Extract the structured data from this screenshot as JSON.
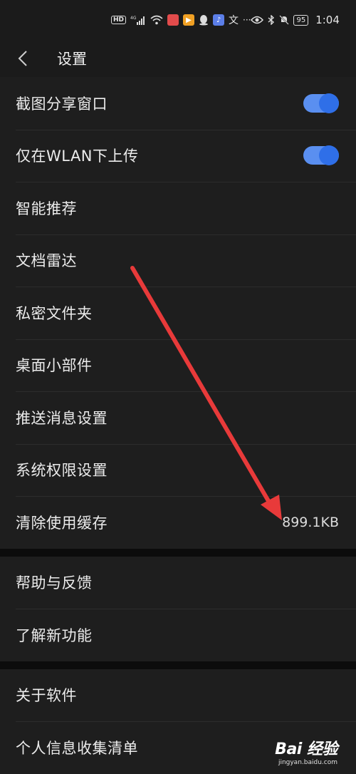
{
  "status_bar": {
    "hd": "HD",
    "network": "4G",
    "battery": "95",
    "time": "1:04",
    "icons": [
      "hd-icon",
      "signal-icon",
      "wifi-icon",
      "app-notification-icon",
      "qq-icon",
      "translate-icon",
      "more-icon",
      "eye-icon",
      "bluetooth-icon",
      "mute-icon",
      "battery-icon"
    ]
  },
  "header": {
    "title": "设置"
  },
  "groups": [
    {
      "rows": [
        {
          "label": "截图分享窗口",
          "toggle": true
        },
        {
          "label": "仅在WLAN下上传",
          "toggle": true
        },
        {
          "label": "智能推荐"
        },
        {
          "label": "文档雷达"
        },
        {
          "label": "私密文件夹"
        },
        {
          "label": "桌面小部件"
        },
        {
          "label": "推送消息设置"
        },
        {
          "label": "系统权限设置"
        },
        {
          "label": "清除使用缓存",
          "value": "899.1KB"
        }
      ]
    },
    {
      "rows": [
        {
          "label": "帮助与反馈"
        },
        {
          "label": "了解新功能"
        }
      ]
    },
    {
      "rows": [
        {
          "label": "关于软件"
        },
        {
          "label": "个人信息收集清单"
        }
      ]
    }
  ],
  "watermark": {
    "logo": "Bai 经验",
    "url": "jingyan.baidu.com"
  },
  "colors": {
    "background": "#1b1b1b",
    "toggle_on": "#2f6fe8",
    "arrow": "#e83a3a"
  }
}
